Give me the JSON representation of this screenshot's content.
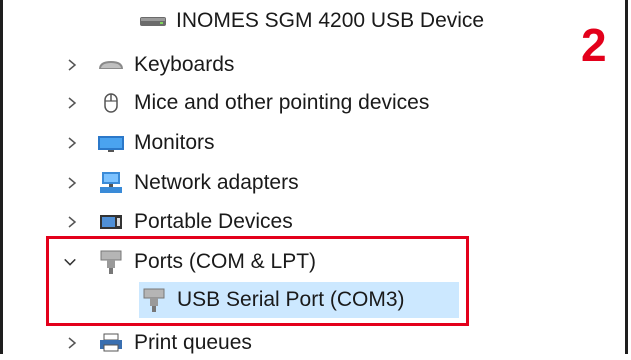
{
  "tree": {
    "items": [
      {
        "label": "INOMES SGM 4200 USB Device",
        "icon": "drive-icon",
        "expanded": null
      },
      {
        "label": "Keyboards",
        "icon": "keyboard-icon",
        "expanded": false
      },
      {
        "label": "Mice and other pointing devices",
        "icon": "mouse-icon",
        "expanded": false
      },
      {
        "label": "Monitors",
        "icon": "monitor-icon",
        "expanded": false
      },
      {
        "label": "Network adapters",
        "icon": "network-adapter-icon",
        "expanded": false
      },
      {
        "label": "Portable Devices",
        "icon": "portable-device-icon",
        "expanded": false
      },
      {
        "label": "Ports (COM & LPT)",
        "icon": "port-connector-icon",
        "expanded": true
      },
      {
        "label": "USB Serial Port (COM3)",
        "icon": "port-connector-icon",
        "selected": true
      },
      {
        "label": "Print queues",
        "icon": "printer-icon",
        "expanded": false
      }
    ]
  },
  "annotation": {
    "step_number": "2",
    "highlight_color": "#e3001b"
  },
  "colors": {
    "selection": "#cce8ff",
    "chevron": "#555555"
  }
}
